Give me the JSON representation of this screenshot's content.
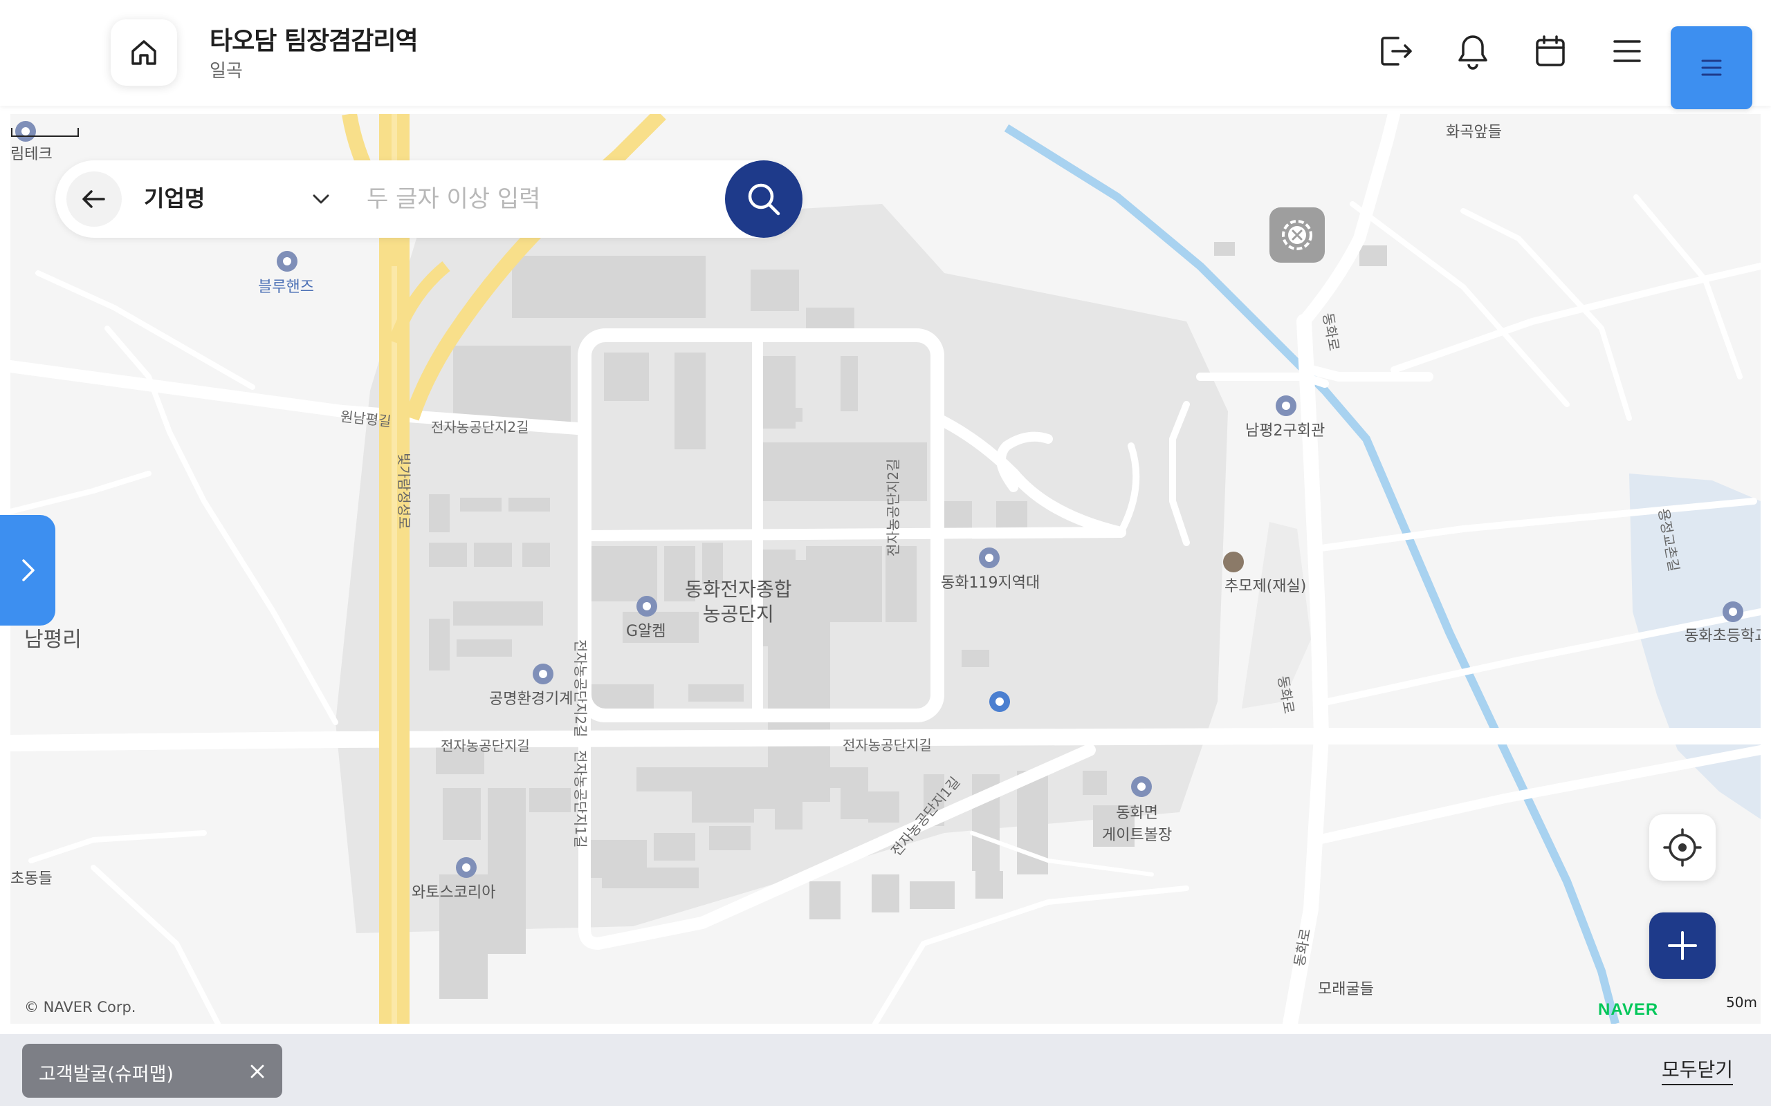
{
  "header": {
    "title": "타오담 팀장겸감리역",
    "subtitle": "일곡",
    "icons": [
      "home-icon",
      "logout-icon",
      "bell-icon",
      "calendar-icon",
      "menu-icon",
      "hamburger-icon"
    ]
  },
  "search": {
    "select_label": "기업명",
    "placeholder": "두 글자 이상 입력"
  },
  "map": {
    "copyright": "© NAVER Corp.",
    "logo": "NAVER",
    "scale": "50m",
    "labels": {
      "limtech": "림테크",
      "bluehands": "블루핸즈",
      "nampyeongri": "남평리",
      "chodongdeul": "초동들",
      "complex_1": "동화전자종합",
      "complex_2": "농공단지",
      "galchem": "G알켐",
      "gongmyeong": "공명환경기계",
      "watos": "와토스코리아",
      "fire_station": "동화119지역대",
      "hall": "남평2구회관",
      "chumoje": "추모제(재실)",
      "hwagok": "화곡앞들",
      "school": "동화초등학교",
      "gate_1": "동화면",
      "gate_2": "게이트볼장",
      "moraegul": "모래굴들"
    },
    "roads": {
      "wonnampyeong": "원남평길",
      "r_2gil_a": "전자농공단지2길",
      "r_2gil_b": "전자농공단지2길",
      "r_2gil_c": "전자농공단지2길",
      "r_gil_a": "전자농공단지길",
      "r_gil_b": "전자농공단지길",
      "r_1gil_a": "전자농공단지1길",
      "r_1gil_b": "전자농공단지1길",
      "bitgaram": "빛가람정성로",
      "donghwa_a": "동화로",
      "donghwa_b": "동화로",
      "donghwa_c": "동화로",
      "yongjeong": "용정교촌길"
    }
  },
  "bottom": {
    "chip_label": "고객발굴(슈퍼맵)",
    "close_all": "모두닫기"
  },
  "colors": {
    "primary_blue": "#3d8ff0",
    "navy": "#1e3a8a",
    "naver_green": "#03c75a"
  }
}
